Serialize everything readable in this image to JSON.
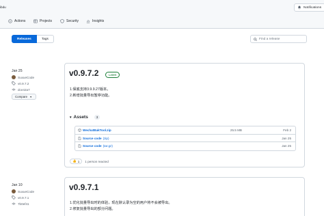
{
  "header": {
    "repo_fragment": "ibdu",
    "notifications_label": "Notifications"
  },
  "tabs": [
    {
      "label": "Actions"
    },
    {
      "label": "Projects"
    },
    {
      "label": "Security"
    },
    {
      "label": "Insights"
    }
  ],
  "subnav": {
    "releases_label": "Releases",
    "tags_label": "Tags",
    "search_placeholder": "Find a release"
  },
  "releases": [
    {
      "date": "Jan 25",
      "author": "SuxueCode",
      "tag": "v0.9.7.2",
      "commit": "dce42a7",
      "compare_label": "Compare",
      "title": "v0.9.7.2",
      "badge": "Latest",
      "notes": [
        "1.保底支持3.9.9.27版本。",
        "2.新增批量导出暂停功能。"
      ],
      "assets_label": "Assets",
      "assets_count": "3",
      "assets": [
        {
          "name": "WechatBakTool.zip",
          "size": "25.5 MB",
          "date": "Feb 2",
          "icon": "package-icon"
        },
        {
          "name": "Source code",
          "ext": "(zip)",
          "size": "",
          "date": "Jan 25",
          "icon": "file-zip-icon"
        },
        {
          "name": "Source code",
          "ext": "(tar.gz)",
          "size": "",
          "date": "Jan 25",
          "icon": "file-zip-icon"
        }
      ],
      "reaction_emoji": "👍",
      "reaction_count": "1",
      "reaction_text": "1 person reacted"
    },
    {
      "date": "Jan 10",
      "author": "SuxueCode",
      "tag": "v0.9.7.1",
      "commit": "7b0ef41",
      "title": "v0.9.7.1",
      "notes": [
        "1.优化批量导出时的体验，现在默认录为空的用户将不会被导出。",
        "2.修复批量导出的部分问题。"
      ]
    }
  ],
  "colors": {
    "accent": "#0969da",
    "latest_green": "#1a7f37",
    "border": "#d0d7de"
  }
}
